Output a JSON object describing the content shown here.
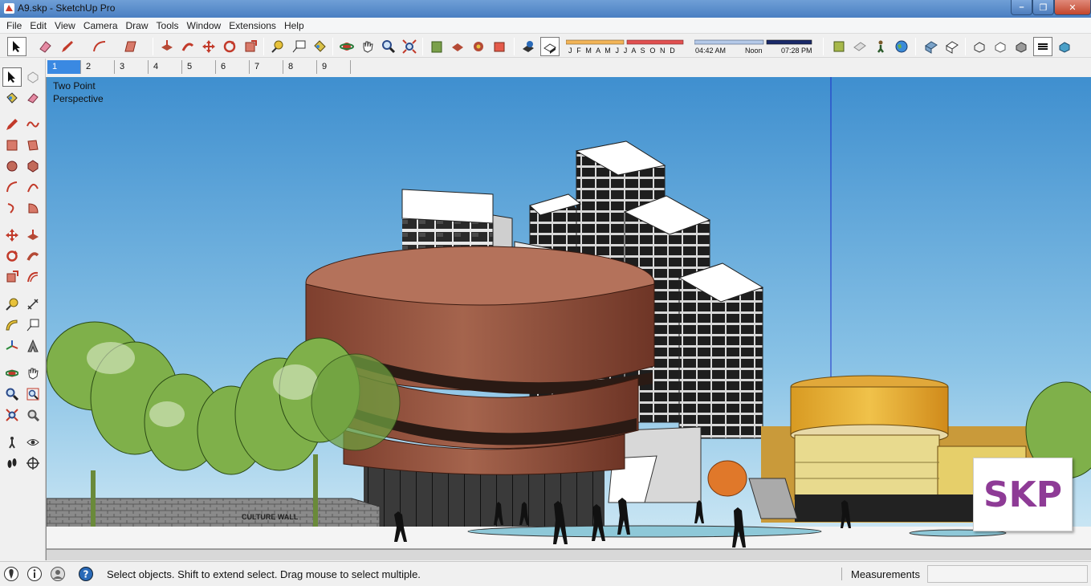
{
  "window": {
    "title": "A9.skp - SketchUp Pro",
    "minimize": "–",
    "restore": "❐",
    "close": "✕"
  },
  "menu": [
    "File",
    "Edit",
    "View",
    "Camera",
    "Draw",
    "Tools",
    "Window",
    "Extensions",
    "Help"
  ],
  "shadow_settings": {
    "months": "J F M A M J J A S O N D",
    "time_start": "04:42 AM",
    "time_noon": "Noon",
    "time_end": "07:28 PM"
  },
  "scenes": [
    "1",
    "2",
    "3",
    "4",
    "5",
    "6",
    "7",
    "8",
    "9"
  ],
  "active_scene": "1",
  "viewport": {
    "camera_label_line1": "Two Point",
    "camera_label_line2": "Perspective",
    "wall_sign": "CULTURE WALL",
    "badge": "SKP"
  },
  "status": {
    "message": "Select objects. Shift to extend select. Drag mouse to select multiple.",
    "measurements_label": "Measurements",
    "measurements_value": ""
  },
  "colors": {
    "sky_top": "#3f8fcf",
    "sky_bottom": "#d5ecf6",
    "rotunda": "#9a5a44",
    "yellow_building": "#e6b23a",
    "badge_text": "#8e3b96",
    "accent_tab": "#3a89e2"
  }
}
